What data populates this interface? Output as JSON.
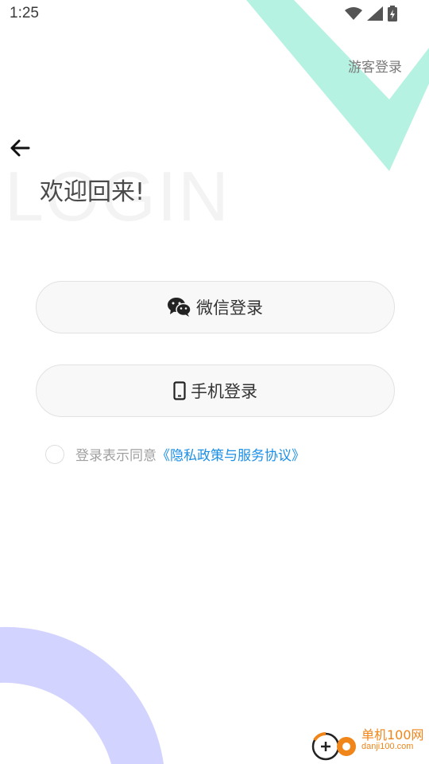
{
  "status_bar": {
    "time": "1:25",
    "icons": [
      "wifi-icon",
      "signal-icon",
      "battery-icon"
    ]
  },
  "header": {
    "guest_login": "游客登录"
  },
  "hero": {
    "watermark": "LOGIN",
    "welcome": "欢迎回来!"
  },
  "buttons": {
    "wechat_login": "微信登录",
    "phone_login": "手机登录"
  },
  "agreement": {
    "prefix": "登录表示同意",
    "link": "《隐私政策与服务协议》",
    "checked": false
  },
  "watermark_site": {
    "name": "单机100网",
    "url": "danji100.com"
  },
  "colors": {
    "mint": "#b6f2e1",
    "lavender": "#d3d3ff",
    "link": "#1a8fe8",
    "site_orange": "#f08519"
  }
}
